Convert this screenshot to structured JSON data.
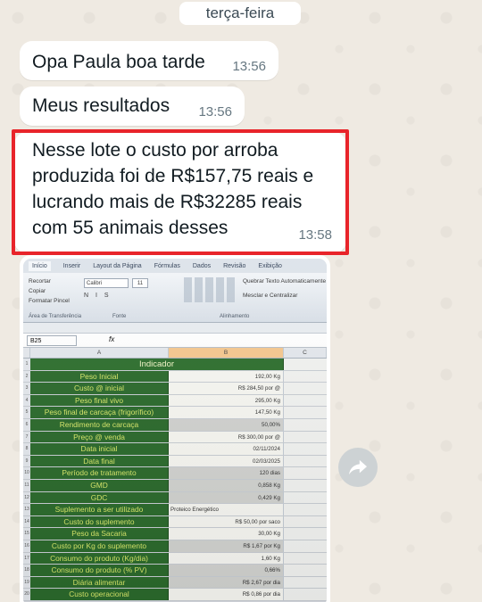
{
  "chat": {
    "date_separator": "terça-feira",
    "messages": [
      {
        "text": "Opa Paula boa tarde",
        "time": "13:56"
      },
      {
        "text": "Meus resultados",
        "time": "13:56"
      },
      {
        "text": "Nesse lote o custo por arroba produzida foi de R$157,75 reais e lucrando mais de R$32285 reais com 55 animais desses",
        "time": "13:58",
        "highlighted": true
      }
    ],
    "highlight_color": "#e8242a",
    "share_icon": "forward-arrow-icon"
  },
  "spreadsheet": {
    "tabs": [
      "Início",
      "Inserir",
      "Layout da Página",
      "Fórmulas",
      "Dados",
      "Revisão",
      "Exibição"
    ],
    "clipboard": [
      "Recortar",
      "Copiar",
      "Formatar Pincel"
    ],
    "clipboard_group": "Área de Transferência",
    "font_name": "Calibri",
    "font_size": "11",
    "font_tools": "N I S",
    "font_group": "Fonte",
    "wrap_text": "Quebrar Texto Automaticamente",
    "merge_center": "Mesclar e Centralizar",
    "align_group": "Alinhamento",
    "name_box": "B25",
    "fx": "fx",
    "columns": [
      "A",
      "B",
      "C"
    ],
    "header": "Indicador",
    "rows": [
      {
        "n": "2",
        "label": "Peso Inicial",
        "value": "192,00 Kg"
      },
      {
        "n": "3",
        "label": "Custo @ inicial",
        "value": "R$ 284,50 por @"
      },
      {
        "n": "4",
        "label": "Peso final vivo",
        "value": "295,00 Kg"
      },
      {
        "n": "5",
        "label": "Peso final de carcaça (frigorífico)",
        "value": "147,50 Kg"
      },
      {
        "n": "6",
        "label": "Rendimento de carcaça",
        "value": "50,00%",
        "shade": true
      },
      {
        "n": "7",
        "label": "Preço @ venda",
        "value": "R$ 300,00 por @"
      },
      {
        "n": "8",
        "label": "Data inicial",
        "value": "02/11/2024"
      },
      {
        "n": "9",
        "label": "Data final",
        "value": "02/03/2025"
      },
      {
        "n": "10",
        "label": "Período de tratamento",
        "value": "120 dias",
        "shade": true
      },
      {
        "n": "11",
        "label": "GMD",
        "value": "0,858 Kg",
        "shade": true
      },
      {
        "n": "12",
        "label": "GDC",
        "value": "0,429 Kg",
        "shade": true
      },
      {
        "n": "13",
        "label": "Suplemento a ser utilizado",
        "value": "Proteico Energético",
        "left": true
      },
      {
        "n": "14",
        "label": "Custo do suplemento",
        "value": "R$ 50,00 por saco"
      },
      {
        "n": "15",
        "label": "Peso da Sacaria",
        "value": "30,00 Kg"
      },
      {
        "n": "16",
        "label": "Custo por Kg do suplemento",
        "value": "R$ 1,67 por Kg",
        "shade": true
      },
      {
        "n": "17",
        "label": "Consumo do produto (Kg/dia)",
        "value": "1,60 Kg"
      },
      {
        "n": "18",
        "label": "Consumo do produto (% PV)",
        "value": "0,66%",
        "shade": true
      },
      {
        "n": "19",
        "label": "Diária alimentar",
        "value": "R$ 2,67 por dia",
        "shade": true
      },
      {
        "n": "20",
        "label": "Custo operacional",
        "value": "R$ 0,86 por dia"
      }
    ]
  }
}
